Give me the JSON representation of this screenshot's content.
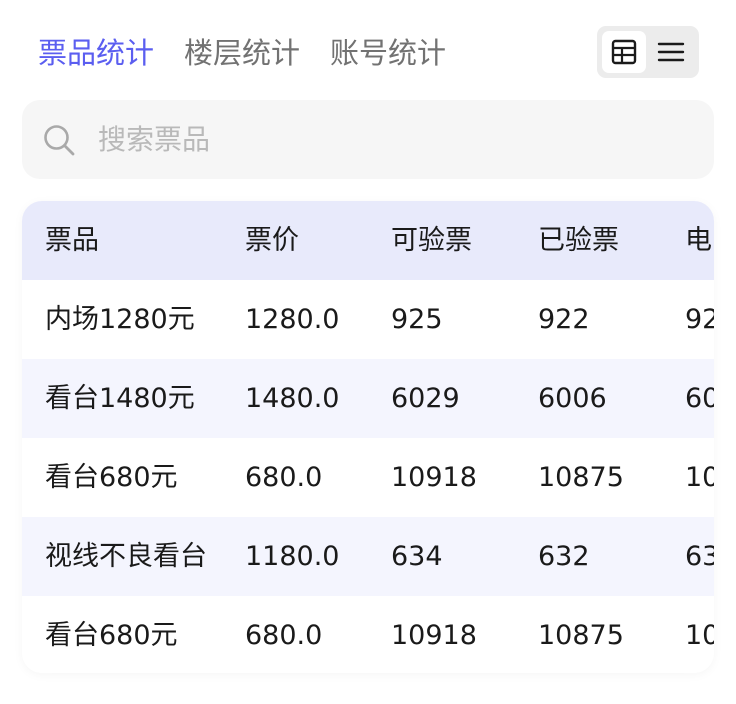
{
  "tabs": [
    {
      "label": "票品统计",
      "active": true
    },
    {
      "label": "楼层统计",
      "active": false
    },
    {
      "label": "账号统计",
      "active": false
    }
  ],
  "view_toggle": {
    "selected": "table",
    "icons": [
      "table-icon",
      "list-icon"
    ]
  },
  "search": {
    "placeholder": "搜索票品",
    "value": ""
  },
  "colors": {
    "accent": "#5b5ef0",
    "header_bg": "#e8eafb",
    "stripe_bg": "#f4f5fe",
    "search_bg": "#f6f6f6"
  },
  "table": {
    "columns": [
      "票品",
      "票价",
      "可验票",
      "已验票",
      "电"
    ],
    "rows": [
      [
        "内场1280元",
        "1280.0",
        "925",
        "922",
        "92"
      ],
      [
        "看台1480元",
        "1480.0",
        "6029",
        "6006",
        "60"
      ],
      [
        "看台680元",
        "680.0",
        "10918",
        "10875",
        "10"
      ],
      [
        "视线不良看台",
        "1180.0",
        "634",
        "632",
        "63"
      ],
      [
        "看台680元",
        "680.0",
        "10918",
        "10875",
        "10"
      ]
    ]
  }
}
